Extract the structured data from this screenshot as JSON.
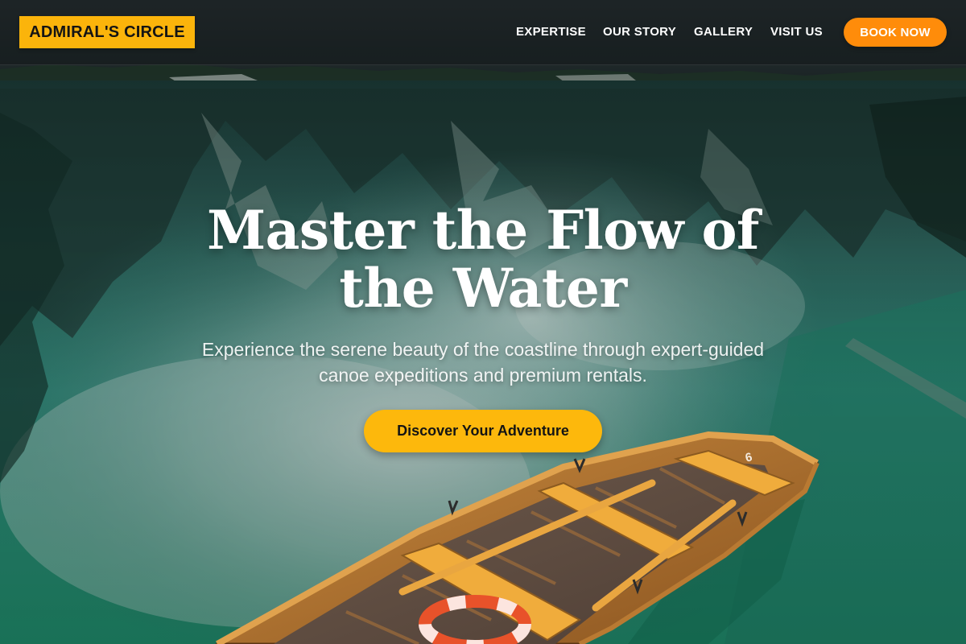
{
  "header": {
    "logo_text": "ADMIRAL'S CIRCLE",
    "nav": [
      {
        "label": "EXPERTISE"
      },
      {
        "label": "OUR STORY"
      },
      {
        "label": "GALLERY"
      },
      {
        "label": "VISIT US"
      }
    ],
    "book_label": "BOOK NOW"
  },
  "hero": {
    "title": "Master the Flow of the Water",
    "subtitle": "Experience the serene beauty of the coastline through expert-guided canoe expeditions and premium rentals.",
    "cta_label": "Discover Your Adventure",
    "boat_number": "6"
  },
  "colors": {
    "accent": "#fbb40b",
    "book_button": "#ff8c0a",
    "water": "#1c8a78"
  },
  "icons": {
    "hero_image": "lake-rowboat-photo"
  }
}
